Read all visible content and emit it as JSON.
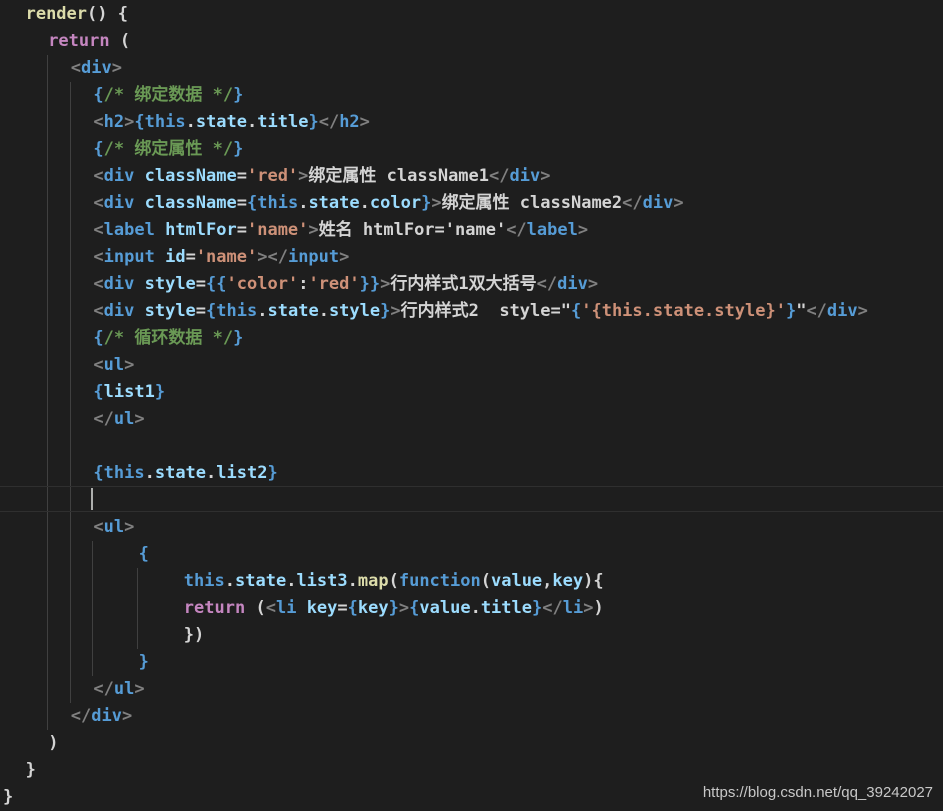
{
  "colors": {
    "background": "#1e1e1e",
    "plain": "#d4d4d4",
    "keyword": "#c586c0",
    "function": "#dcdcaa",
    "this": "#569cd6",
    "property": "#9cdcfe",
    "tag": "#569cd6",
    "bracket": "#808080",
    "string": "#ce9178",
    "comment": "#6a9955",
    "guide": "#404040",
    "cursor": "#aeafad"
  },
  "code_lines": [
    {
      "indent": 1,
      "tokens": [
        {
          "t": "render",
          "c": "function"
        },
        {
          "t": "() {",
          "c": "plain"
        }
      ]
    },
    {
      "indent": 2,
      "tokens": [
        {
          "t": "return",
          "c": "keyword"
        },
        {
          "t": " (",
          "c": "plain"
        }
      ]
    },
    {
      "indent": 3,
      "tokens": [
        {
          "t": "<",
          "c": "bracket"
        },
        {
          "t": "div",
          "c": "tag"
        },
        {
          "t": ">",
          "c": "bracket"
        }
      ]
    },
    {
      "indent": 4,
      "tokens": [
        {
          "t": "{",
          "c": "this"
        },
        {
          "t": "/* 绑定数据 */",
          "c": "comment"
        },
        {
          "t": "}",
          "c": "this"
        }
      ]
    },
    {
      "indent": 4,
      "tokens": [
        {
          "t": "<",
          "c": "bracket"
        },
        {
          "t": "h2",
          "c": "tag"
        },
        {
          "t": ">",
          "c": "bracket"
        },
        {
          "t": "{",
          "c": "this"
        },
        {
          "t": "this",
          "c": "this"
        },
        {
          "t": ".",
          "c": "plain"
        },
        {
          "t": "state",
          "c": "property"
        },
        {
          "t": ".",
          "c": "plain"
        },
        {
          "t": "title",
          "c": "property"
        },
        {
          "t": "}",
          "c": "this"
        },
        {
          "t": "</",
          "c": "bracket"
        },
        {
          "t": "h2",
          "c": "tag"
        },
        {
          "t": ">",
          "c": "bracket"
        }
      ]
    },
    {
      "indent": 4,
      "tokens": [
        {
          "t": "{",
          "c": "this"
        },
        {
          "t": "/* 绑定属性 */",
          "c": "comment"
        },
        {
          "t": "}",
          "c": "this"
        }
      ]
    },
    {
      "indent": 4,
      "tokens": [
        {
          "t": "<",
          "c": "bracket"
        },
        {
          "t": "div",
          "c": "tag"
        },
        {
          "t": " ",
          "c": "plain"
        },
        {
          "t": "className",
          "c": "property"
        },
        {
          "t": "=",
          "c": "plain"
        },
        {
          "t": "'red'",
          "c": "string"
        },
        {
          "t": ">",
          "c": "bracket"
        },
        {
          "t": "绑定属性 className1",
          "c": "plain"
        },
        {
          "t": "</",
          "c": "bracket"
        },
        {
          "t": "div",
          "c": "tag"
        },
        {
          "t": ">",
          "c": "bracket"
        }
      ]
    },
    {
      "indent": 4,
      "tokens": [
        {
          "t": "<",
          "c": "bracket"
        },
        {
          "t": "div",
          "c": "tag"
        },
        {
          "t": " ",
          "c": "plain"
        },
        {
          "t": "className",
          "c": "property"
        },
        {
          "t": "=",
          "c": "plain"
        },
        {
          "t": "{",
          "c": "this"
        },
        {
          "t": "this",
          "c": "this"
        },
        {
          "t": ".",
          "c": "plain"
        },
        {
          "t": "state",
          "c": "property"
        },
        {
          "t": ".",
          "c": "plain"
        },
        {
          "t": "color",
          "c": "property"
        },
        {
          "t": "}",
          "c": "this"
        },
        {
          "t": ">",
          "c": "bracket"
        },
        {
          "t": "绑定属性 className2",
          "c": "plain"
        },
        {
          "t": "</",
          "c": "bracket"
        },
        {
          "t": "div",
          "c": "tag"
        },
        {
          "t": ">",
          "c": "bracket"
        }
      ]
    },
    {
      "indent": 4,
      "tokens": [
        {
          "t": "<",
          "c": "bracket"
        },
        {
          "t": "label",
          "c": "tag"
        },
        {
          "t": " ",
          "c": "plain"
        },
        {
          "t": "htmlFor",
          "c": "property"
        },
        {
          "t": "=",
          "c": "plain"
        },
        {
          "t": "'name'",
          "c": "string"
        },
        {
          "t": ">",
          "c": "bracket"
        },
        {
          "t": "姓名 htmlFor='name'",
          "c": "plain"
        },
        {
          "t": "</",
          "c": "bracket"
        },
        {
          "t": "label",
          "c": "tag"
        },
        {
          "t": ">",
          "c": "bracket"
        }
      ]
    },
    {
      "indent": 4,
      "tokens": [
        {
          "t": "<",
          "c": "bracket"
        },
        {
          "t": "input",
          "c": "tag"
        },
        {
          "t": " ",
          "c": "plain"
        },
        {
          "t": "id",
          "c": "property"
        },
        {
          "t": "=",
          "c": "plain"
        },
        {
          "t": "'name'",
          "c": "string"
        },
        {
          "t": "></",
          "c": "bracket"
        },
        {
          "t": "input",
          "c": "tag"
        },
        {
          "t": ">",
          "c": "bracket"
        }
      ]
    },
    {
      "indent": 4,
      "tokens": [
        {
          "t": "<",
          "c": "bracket"
        },
        {
          "t": "div",
          "c": "tag"
        },
        {
          "t": " ",
          "c": "plain"
        },
        {
          "t": "style",
          "c": "property"
        },
        {
          "t": "=",
          "c": "plain"
        },
        {
          "t": "{{",
          "c": "this"
        },
        {
          "t": "'color'",
          "c": "string"
        },
        {
          "t": ":",
          "c": "plain"
        },
        {
          "t": "'red'",
          "c": "string"
        },
        {
          "t": "}}",
          "c": "this"
        },
        {
          "t": ">",
          "c": "bracket"
        },
        {
          "t": "行内样式1双大括号",
          "c": "plain"
        },
        {
          "t": "</",
          "c": "bracket"
        },
        {
          "t": "div",
          "c": "tag"
        },
        {
          "t": ">",
          "c": "bracket"
        }
      ]
    },
    {
      "indent": 4,
      "tokens": [
        {
          "t": "<",
          "c": "bracket"
        },
        {
          "t": "div",
          "c": "tag"
        },
        {
          "t": " ",
          "c": "plain"
        },
        {
          "t": "style",
          "c": "property"
        },
        {
          "t": "=",
          "c": "plain"
        },
        {
          "t": "{",
          "c": "this"
        },
        {
          "t": "this",
          "c": "this"
        },
        {
          "t": ".",
          "c": "plain"
        },
        {
          "t": "state",
          "c": "property"
        },
        {
          "t": ".",
          "c": "plain"
        },
        {
          "t": "style",
          "c": "property"
        },
        {
          "t": "}",
          "c": "this"
        },
        {
          "t": ">",
          "c": "bracket"
        },
        {
          "t": "行内样式2  style=\"",
          "c": "plain"
        },
        {
          "t": "{",
          "c": "this"
        },
        {
          "t": "'{this.state.style}'",
          "c": "string"
        },
        {
          "t": "}",
          "c": "this"
        },
        {
          "t": "\"",
          "c": "plain"
        },
        {
          "t": "</",
          "c": "bracket"
        },
        {
          "t": "div",
          "c": "tag"
        },
        {
          "t": ">",
          "c": "bracket"
        }
      ]
    },
    {
      "indent": 4,
      "tokens": [
        {
          "t": "{",
          "c": "this"
        },
        {
          "t": "/* 循环数据 */",
          "c": "comment"
        },
        {
          "t": "}",
          "c": "this"
        }
      ]
    },
    {
      "indent": 4,
      "tokens": [
        {
          "t": "<",
          "c": "bracket"
        },
        {
          "t": "ul",
          "c": "tag"
        },
        {
          "t": ">",
          "c": "bracket"
        }
      ]
    },
    {
      "indent": 4,
      "tokens": [
        {
          "t": "{",
          "c": "this"
        },
        {
          "t": "list1",
          "c": "property"
        },
        {
          "t": "}",
          "c": "this"
        }
      ]
    },
    {
      "indent": 4,
      "tokens": [
        {
          "t": "</",
          "c": "bracket"
        },
        {
          "t": "ul",
          "c": "tag"
        },
        {
          "t": ">",
          "c": "bracket"
        }
      ]
    },
    {
      "indent": 0,
      "tokens": []
    },
    {
      "indent": 4,
      "tokens": [
        {
          "t": "{",
          "c": "this"
        },
        {
          "t": "this",
          "c": "this"
        },
        {
          "t": ".",
          "c": "plain"
        },
        {
          "t": "state",
          "c": "property"
        },
        {
          "t": ".",
          "c": "plain"
        },
        {
          "t": "list2",
          "c": "property"
        },
        {
          "t": "}",
          "c": "this"
        }
      ]
    },
    {
      "indent": 0,
      "tokens": []
    },
    {
      "indent": 4,
      "tokens": [
        {
          "t": "<",
          "c": "bracket"
        },
        {
          "t": "ul",
          "c": "tag"
        },
        {
          "t": ">",
          "c": "bracket"
        }
      ]
    },
    {
      "indent": 6,
      "tokens": [
        {
          "t": "{",
          "c": "this"
        }
      ]
    },
    {
      "indent": 8,
      "tokens": [
        {
          "t": "this",
          "c": "this"
        },
        {
          "t": ".",
          "c": "plain"
        },
        {
          "t": "state",
          "c": "property"
        },
        {
          "t": ".",
          "c": "plain"
        },
        {
          "t": "list3",
          "c": "property"
        },
        {
          "t": ".",
          "c": "plain"
        },
        {
          "t": "map",
          "c": "function"
        },
        {
          "t": "(",
          "c": "plain"
        },
        {
          "t": "function",
          "c": "this"
        },
        {
          "t": "(",
          "c": "plain"
        },
        {
          "t": "value",
          "c": "property"
        },
        {
          "t": ",",
          "c": "plain"
        },
        {
          "t": "key",
          "c": "property"
        },
        {
          "t": "){",
          "c": "plain"
        }
      ]
    },
    {
      "indent": 8,
      "tokens": [
        {
          "t": "return",
          "c": "keyword"
        },
        {
          "t": " (",
          "c": "plain"
        },
        {
          "t": "<",
          "c": "bracket"
        },
        {
          "t": "li",
          "c": "tag"
        },
        {
          "t": " ",
          "c": "plain"
        },
        {
          "t": "key",
          "c": "property"
        },
        {
          "t": "=",
          "c": "plain"
        },
        {
          "t": "{",
          "c": "this"
        },
        {
          "t": "key",
          "c": "property"
        },
        {
          "t": "}",
          "c": "this"
        },
        {
          "t": ">",
          "c": "bracket"
        },
        {
          "t": "{",
          "c": "this"
        },
        {
          "t": "value",
          "c": "property"
        },
        {
          "t": ".",
          "c": "plain"
        },
        {
          "t": "title",
          "c": "property"
        },
        {
          "t": "}",
          "c": "this"
        },
        {
          "t": "</",
          "c": "bracket"
        },
        {
          "t": "li",
          "c": "tag"
        },
        {
          "t": ">",
          "c": "bracket"
        },
        {
          "t": ")",
          "c": "plain"
        }
      ]
    },
    {
      "indent": 8,
      "tokens": [
        {
          "t": "})",
          "c": "plain"
        }
      ]
    },
    {
      "indent": 6,
      "tokens": [
        {
          "t": "}",
          "c": "this"
        }
      ]
    },
    {
      "indent": 4,
      "tokens": [
        {
          "t": "</",
          "c": "bracket"
        },
        {
          "t": "ul",
          "c": "tag"
        },
        {
          "t": ">",
          "c": "bracket"
        }
      ]
    },
    {
      "indent": 3,
      "tokens": [
        {
          "t": "</",
          "c": "bracket"
        },
        {
          "t": "div",
          "c": "tag"
        },
        {
          "t": ">",
          "c": "bracket"
        }
      ]
    },
    {
      "indent": 2,
      "tokens": [
        {
          "t": ")",
          "c": "plain"
        }
      ]
    },
    {
      "indent": 1,
      "tokens": [
        {
          "t": "}",
          "c": "plain"
        }
      ]
    },
    {
      "indent": 0,
      "tokens": [
        {
          "t": "}",
          "c": "plain"
        }
      ]
    }
  ],
  "watermark": "https://blog.csdn.net/qq_39242027"
}
